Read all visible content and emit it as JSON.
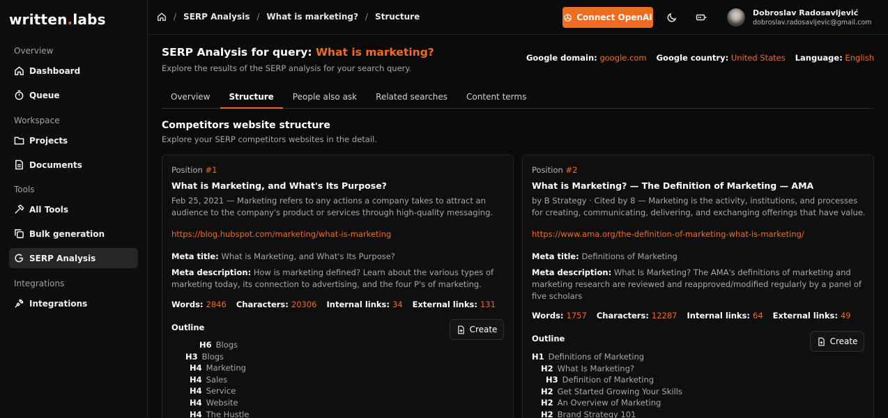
{
  "app": {
    "logo_main": "written",
    "logo_dot": ".",
    "logo_tail": "labs"
  },
  "sidebar": {
    "sections": [
      "Overview",
      "Workspace",
      "Tools",
      "Integrations"
    ],
    "items": [
      {
        "label": "Dashboard",
        "icon": "home-icon"
      },
      {
        "label": "Queue",
        "icon": "timer-icon"
      },
      {
        "label": "Projects",
        "icon": "folder-icon"
      },
      {
        "label": "Documents",
        "icon": "document-icon"
      },
      {
        "label": "All Tools",
        "icon": "hammer-icon"
      },
      {
        "label": "Bulk generation",
        "icon": "copy-icon"
      },
      {
        "label": "SERP Analysis",
        "icon": "google-icon",
        "active": true
      },
      {
        "label": "Integrations",
        "icon": "plug-icon"
      }
    ]
  },
  "header": {
    "breadcrumbs": [
      "SERP Analysis",
      "What is marketing?",
      "Structure"
    ],
    "connect_label": "Connect OpenAI",
    "user_name": "Dobroslav Radosavljević",
    "user_email": "dobroslav.radosavljevic@gmail.com"
  },
  "page": {
    "title_prefix": "SERP Analysis for query:",
    "title_query": "What is marketing?",
    "subtitle": "Explore the results of the SERP analysis for your search query.",
    "domain_label": "Google domain:",
    "domain_value": "google.com",
    "country_label": "Google country:",
    "country_value": "United States",
    "language_label": "Language:",
    "language_value": "English"
  },
  "tabs": [
    "Overview",
    "Structure",
    "People also ask",
    "Related searches",
    "Content terms"
  ],
  "section": {
    "title": "Competitors website structure",
    "subtitle": "Explore your SERP competitors websites in the detail."
  },
  "labels": {
    "position": "Position",
    "meta_title": "Meta title:",
    "meta_description": "Meta description:",
    "words": "Words:",
    "characters": "Characters:",
    "internal_links": "Internal links:",
    "external_links": "External links:",
    "outline": "Outline",
    "create": "Create"
  },
  "results": [
    {
      "position": "#1",
      "title": "What is Marketing, and What's Its Purpose?",
      "snippet": "Feb 25, 2021 — Marketing refers to any actions a company takes to attract an audience to the company's product or services through high-quality messaging.",
      "url": "https://blog.hubspot.com/marketing/what-is-marketing",
      "meta_title": "What is Marketing, and What's Its Purpose?",
      "meta_description": "How is marketing defined? Learn about the various types of marketing today, its connection to advertising, and the four P's of marketing.",
      "words": "2846",
      "characters": "20306",
      "internal_links": "34",
      "external_links": "131",
      "outline": [
        {
          "tag": "H6",
          "text": "Blogs",
          "indent": 40
        },
        {
          "tag": "H3",
          "text": "Blogs",
          "indent": 20
        },
        {
          "tag": "H4",
          "text": "Marketing",
          "indent": 26
        },
        {
          "tag": "H4",
          "text": "Sales",
          "indent": 26
        },
        {
          "tag": "H4",
          "text": "Service",
          "indent": 26
        },
        {
          "tag": "H4",
          "text": "Website",
          "indent": 26
        },
        {
          "tag": "H4",
          "text": "The Hustle",
          "indent": 26
        }
      ]
    },
    {
      "position": "#2",
      "title": "What is Marketing? — The Definition of Marketing — AMA",
      "snippet": "by B Strategy · Cited by 8 — Marketing is the activity, institutions, and processes for creating, communicating, delivering, and exchanging offerings that have value.",
      "url": "https://www.ama.org/the-definition-of-marketing-what-is-marketing/",
      "meta_title": "Definitions of Marketing",
      "meta_description": "What Is Marketing? The AMA's definitions of marketing and marketing research are reviewed and reapproved/modified regularly by a panel of five scholars",
      "words": "1757",
      "characters": "12287",
      "internal_links": "64",
      "external_links": "49",
      "outline": [
        {
          "tag": "H1",
          "text": "Definitions of Marketing",
          "indent": 0
        },
        {
          "tag": "H2",
          "text": "What Is Marketing?",
          "indent": 13
        },
        {
          "tag": "H3",
          "text": "Definition of Marketing",
          "indent": 20
        },
        {
          "tag": "H2",
          "text": "Get Started Growing Your Skills",
          "indent": 13
        },
        {
          "tag": "H2",
          "text": "An Overview of Marketing",
          "indent": 13
        },
        {
          "tag": "H2",
          "text": "Brand Strategy 101",
          "indent": 13
        }
      ]
    }
  ],
  "colors": {
    "accent": "#f26b21",
    "background": "#0b0b0c",
    "card": "#0f0f10",
    "active_nav": "#262628"
  }
}
